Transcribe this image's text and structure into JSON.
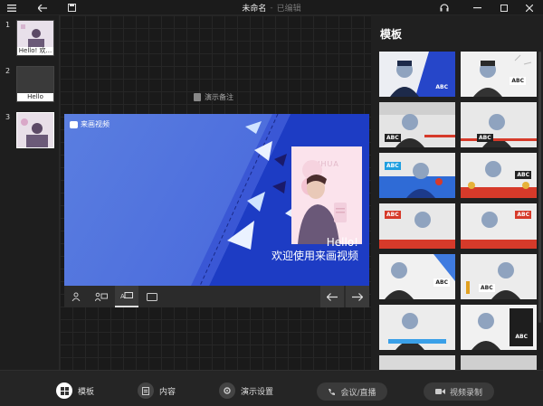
{
  "window": {
    "title": "未命名",
    "separator": "-",
    "status": "已编辑"
  },
  "slides": [
    {
      "number": "1",
      "caption": "Hello! 欢..."
    },
    {
      "number": "2",
      "caption": "Hello"
    },
    {
      "number": "3",
      "caption": ""
    }
  ],
  "canvas": {
    "notes_label": "演示备注",
    "stage": {
      "logo_text": "来画视频",
      "watermark": "LAIHUA",
      "hello_line1": "Hello!",
      "hello_line2": "欢迎使用来画视频"
    }
  },
  "panel": {
    "title": "模板",
    "tags": [
      "ABC",
      "ABC",
      "ABC",
      "ABC",
      "ABC",
      "ABC",
      "ABC",
      "ABC",
      "ABC",
      "ABC",
      "ABC"
    ]
  },
  "bottombar": {
    "template_label": "模板",
    "content_label": "内容",
    "settings_label": "演示设置",
    "meeting_label": "会议/直播",
    "record_label": "视频录制"
  },
  "colors": {
    "stage_blue": "#4d6edd",
    "stage_dark": "#1d3cc4",
    "template_blue": "#2646c9",
    "accent_red": "#d63a2a"
  },
  "icons": [
    "menu-icon",
    "back-icon",
    "save-icon",
    "headset-icon",
    "minimize-icon",
    "maximize-icon",
    "close-icon",
    "notes-icon",
    "person-icon",
    "person-board-icon",
    "text-board-icon",
    "blank-board-icon",
    "arrow-left-icon",
    "arrow-right-icon",
    "template-icon",
    "content-icon",
    "gear-icon",
    "phone-icon",
    "video-camera-icon"
  ]
}
